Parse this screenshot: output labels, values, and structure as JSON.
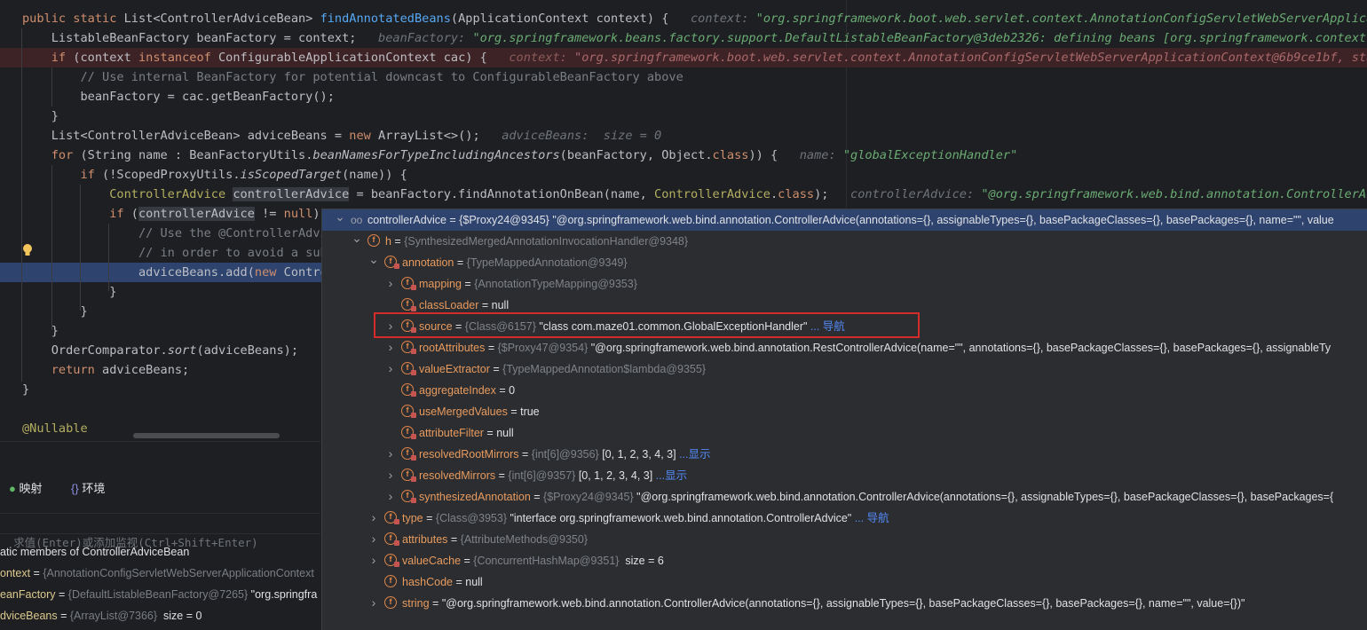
{
  "code_lines": [
    {
      "parts": [
        [
          "kw",
          "public static "
        ],
        [
          "ty",
          "List<ControllerAdviceBean> "
        ],
        [
          "fn",
          "findAnnotatedBeans"
        ],
        [
          "ty",
          "(ApplicationContext context) {   "
        ],
        [
          "inl",
          "context: "
        ],
        [
          "inlstr",
          "\"org.springframework.boot.web.servlet.context.AnnotationConfigServletWebServerApplication"
        ]
      ]
    },
    {
      "parts": [
        [
          "ty",
          "    ListableBeanFactory beanFactory = context;   "
        ],
        [
          "inl",
          "beanFactory: "
        ],
        [
          "inlstr",
          "\"org.springframework.beans.factory.support.DefaultListableBeanFactory@3deb2326: defining beans [org.springframework.context.anno"
        ]
      ]
    },
    {
      "parts": [
        [
          "kw",
          "    if "
        ],
        [
          "ty",
          "(context "
        ],
        [
          "kw",
          "instanceof "
        ],
        [
          "ty",
          "ConfigurableApplicationContext cac) {   "
        ],
        [
          "inlred",
          "context: "
        ],
        [
          "inlredstr",
          "\"org.springframework.boot.web.servlet.context.AnnotationConfigServletWebServerApplicationContext@6b9ce1bf, started"
        ]
      ]
    },
    {
      "parts": [
        [
          "cm",
          "        // Use internal BeanFactory for potential downcast to ConfigurableBeanFactory above"
        ]
      ]
    },
    {
      "parts": [
        [
          "ty",
          "        beanFactory = cac.getBeanFactory();"
        ]
      ]
    },
    {
      "parts": [
        [
          "ty",
          "    }"
        ]
      ]
    },
    {
      "parts": [
        [
          "ty",
          "    List<ControllerAdviceBean> adviceBeans = "
        ],
        [
          "kw",
          "new "
        ],
        [
          "ty",
          "ArrayList<>();   "
        ],
        [
          "inl",
          "adviceBeans:  size = 0"
        ]
      ]
    },
    {
      "parts": [
        [
          "kw",
          "    for "
        ],
        [
          "ty",
          "(String name : BeanFactoryUtils."
        ],
        [
          "it",
          "beanNamesForTypeIncludingAncestors"
        ],
        [
          "ty",
          "(beanFactory, Object."
        ],
        [
          "kw",
          "class"
        ],
        [
          "ty",
          ")) {   "
        ],
        [
          "inl",
          "name: "
        ],
        [
          "inlstr",
          "\"globalExceptionHandler\""
        ]
      ]
    },
    {
      "parts": [
        [
          "kw",
          "        if "
        ],
        [
          "ty",
          "(!ScopedProxyUtils."
        ],
        [
          "it",
          "isScopedTarget"
        ],
        [
          "ty",
          "(name)) {"
        ]
      ]
    },
    {
      "parts": [
        [
          "cls",
          "            ControllerAdvice "
        ],
        [
          "sel",
          "controllerAdvice"
        ],
        [
          "ty",
          " = beanFactory.findAnnotationOnBean(name, "
        ],
        [
          "cls",
          "ControllerAdvice"
        ],
        [
          "ty",
          "."
        ],
        [
          "kw",
          "class"
        ],
        [
          "ty",
          ");   "
        ],
        [
          "inl",
          "controllerAdvice: "
        ],
        [
          "inlstr",
          "\"@org.springframework.web.bind.annotation.ControllerAdvice"
        ]
      ]
    },
    {
      "parts": [
        [
          "kw",
          "            if "
        ],
        [
          "ty",
          "("
        ],
        [
          "sel",
          "controllerAdvice"
        ],
        [
          "ty",
          " != "
        ],
        [
          "kw",
          "null"
        ],
        [
          "ty",
          ")"
        ]
      ]
    },
    {
      "parts": [
        [
          "cm",
          "                // Use the @ControllerAdvi"
        ]
      ]
    },
    {
      "parts": [
        [
          "cm",
          "                // in order to avoid a sub"
        ]
      ]
    },
    {
      "parts": [
        [
          "ty",
          "                adviceBeans.add("
        ],
        [
          "kw",
          "new "
        ],
        [
          "ty",
          "Contro"
        ]
      ]
    },
    {
      "parts": [
        [
          "ty",
          "            }"
        ]
      ]
    },
    {
      "parts": [
        [
          "ty",
          "        }"
        ]
      ]
    },
    {
      "parts": [
        [
          "ty",
          "    }"
        ]
      ]
    },
    {
      "parts": [
        [
          "ty",
          "    OrderComparator."
        ],
        [
          "it",
          "sort"
        ],
        [
          "ty",
          "(adviceBeans);"
        ]
      ]
    },
    {
      "parts": [
        [
          "kw",
          "    return "
        ],
        [
          "ty",
          "adviceBeans;"
        ]
      ]
    },
    {
      "parts": [
        [
          "ty",
          "}"
        ]
      ]
    },
    {
      "parts": [
        [
          "ty",
          ""
        ]
      ]
    },
    {
      "parts": [
        [
          "an",
          "@Nullable"
        ]
      ]
    }
  ],
  "debug_tabs": {
    "mapping_label": "映射",
    "env_label": "环境"
  },
  "watch_placeholder": "求值(Enter)或添加监视(Ctrl+Shift+Enter)",
  "variables": [
    {
      "text": "atic members of ControllerAdviceBean",
      "name": "",
      "ref": "",
      "value": ""
    },
    {
      "name": "ontext",
      "ref": "{AnnotationConfigServletWebServerApplicationContext",
      "value": ""
    },
    {
      "name": "eanFactory",
      "ref": "{DefaultListableBeanFactory@7265}",
      "value": " \"org.springfra"
    },
    {
      "name": "dviceBeans",
      "ref": "{ArrayList@7366}",
      "value": "  size = 0"
    }
  ],
  "tree": [
    {
      "name": "controllerAdvice",
      "ref": "{$Proxy24@9345}",
      "value": "\"@org.springframework.web.bind.annotation.ControllerAdvice(annotations={}, assignableTypes={}, basePackageClasses={}, basePackages={}, name=\"\", value",
      "icon": "oo",
      "chev": "down"
    },
    {
      "name": "h",
      "ref": "{SynthesizedMergedAnnotationInvocationHandler@9348}",
      "value": "",
      "icon": "f",
      "chev": "down"
    },
    {
      "name": "annotation",
      "ref": "{TypeMappedAnnotation@9349}",
      "value": "",
      "icon": "f",
      "chev": "down"
    },
    {
      "name": "mapping",
      "ref": "{AnnotationTypeMapping@9353}",
      "value": "",
      "icon": "f",
      "chev": "right"
    },
    {
      "name": "classLoader",
      "ref": "",
      "value": "null",
      "icon": "f",
      "chev": ""
    },
    {
      "name": "source",
      "ref": "{Class@6157}",
      "value": "\"class com.maze01.common.GlobalExceptionHandler\"",
      "link": "... 导航",
      "icon": "f",
      "chev": "right"
    },
    {
      "name": "rootAttributes",
      "ref": "{$Proxy47@9354}",
      "value": "\"@org.springframework.web.bind.annotation.RestControllerAdvice(name=\"\", annotations={}, basePackageClasses={}, basePackages={}, assignableTy",
      "icon": "f",
      "chev": "right"
    },
    {
      "name": "valueExtractor",
      "ref": "{TypeMappedAnnotation$lambda@9355}",
      "value": "",
      "icon": "f",
      "chev": "right"
    },
    {
      "name": "aggregateIndex",
      "ref": "",
      "value": "0",
      "icon": "f",
      "chev": ""
    },
    {
      "name": "useMergedValues",
      "ref": "",
      "value": "true",
      "icon": "f",
      "chev": ""
    },
    {
      "name": "attributeFilter",
      "ref": "",
      "value": "null",
      "icon": "f",
      "chev": ""
    },
    {
      "name": "resolvedRootMirrors",
      "ref": "{int[6]@9356}",
      "value": "[0, 1, 2, 3, 4, 3]",
      "link": "...显示",
      "icon": "f",
      "chev": "right"
    },
    {
      "name": "resolvedMirrors",
      "ref": "{int[6]@9357}",
      "value": "[0, 1, 2, 3, 4, 3]",
      "link": "...显示",
      "icon": "f",
      "chev": "right"
    },
    {
      "name": "synthesizedAnnotation",
      "ref": "{$Proxy24@9345}",
      "value": "\"@org.springframework.web.bind.annotation.ControllerAdvice(annotations={}, assignableTypes={}, basePackageClasses={}, basePackages={",
      "icon": "f",
      "chev": "right"
    },
    {
      "name": "type",
      "ref": "{Class@3953}",
      "value": "\"interface org.springframework.web.bind.annotation.ControllerAdvice\"",
      "link": "... 导航",
      "icon": "f",
      "chev": "right"
    },
    {
      "name": "attributes",
      "ref": "{AttributeMethods@9350}",
      "value": "",
      "icon": "f",
      "chev": "right"
    },
    {
      "name": "valueCache",
      "ref": "{ConcurrentHashMap@9351}",
      "value": " size = 6",
      "icon": "f",
      "chev": "right"
    },
    {
      "name": "hashCode",
      "ref": "",
      "value": "null",
      "icon": "f",
      "chev": ""
    },
    {
      "name": "string",
      "ref": "",
      "value": "\"@org.springframework.web.bind.annotation.ControllerAdvice(annotations={}, assignableTypes={}, basePackageClasses={}, basePackages={}, name=\"\", value={})\"",
      "icon": "f",
      "chev": "right"
    }
  ]
}
